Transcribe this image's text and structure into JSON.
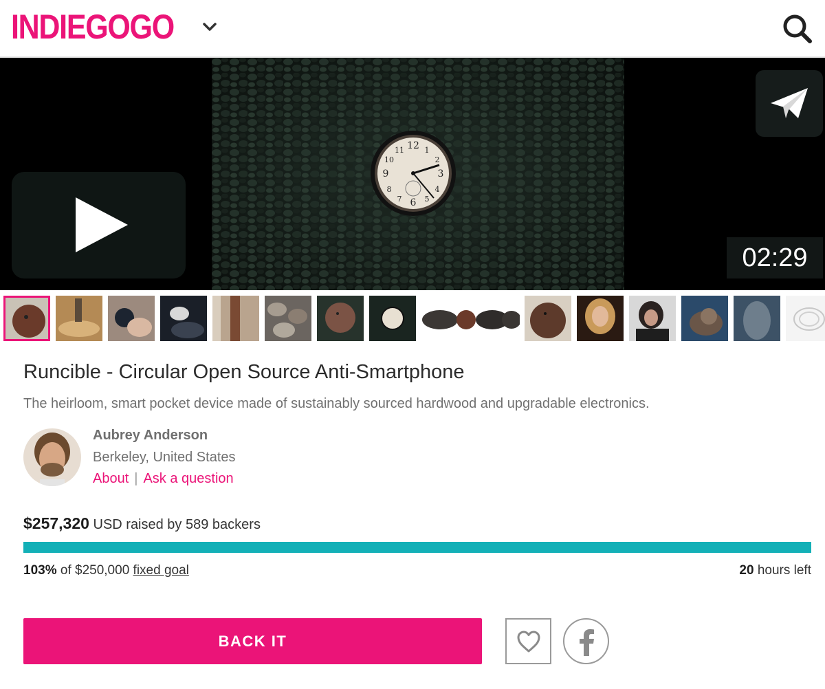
{
  "header": {
    "logo_text": "INDIEGOGO",
    "menu_icon": "chevron-down-icon",
    "search_icon": "search-icon",
    "brand_color": "#eb1478"
  },
  "video": {
    "duration": "02:29",
    "play_icon": "play-icon",
    "share_icon": "paper-plane-icon"
  },
  "gallery": {
    "thumbnails": [
      {
        "label": "wooden device with hole",
        "selected": true
      },
      {
        "label": "wood lathe"
      },
      {
        "label": "hand holding device"
      },
      {
        "label": "dark fur"
      },
      {
        "label": "wood planks"
      },
      {
        "label": "pebbles"
      },
      {
        "label": "wooden disc"
      },
      {
        "label": "pocket watch"
      },
      {
        "label": "three devices"
      },
      {
        "label": "wooden device"
      },
      {
        "label": "woman with blonde hair"
      },
      {
        "label": "woman with phone"
      },
      {
        "label": "snail"
      },
      {
        "label": "fabric"
      },
      {
        "label": "sketch"
      }
    ]
  },
  "campaign": {
    "title": "Runcible - Circular Open Source Anti-Smartphone",
    "tagline": "The heirloom, smart pocket device made of sustainably sourced hardwood and upgradable electronics.",
    "owner": {
      "name": "Aubrey Anderson",
      "location": "Berkeley, United States",
      "about_link": "About",
      "separator": "|",
      "ask_link": "Ask a question"
    },
    "funding": {
      "raised_amount": "$257,320",
      "raised_text": " USD raised by 589 backers",
      "progress_fraction": 1.0,
      "percent": "103%",
      "of_text": " of $250,000 ",
      "goal_type": "fixed goal",
      "time_value": "20",
      "time_unit": " hours left",
      "progress_color": "#13b0b7"
    },
    "actions": {
      "back_label": "BACK IT",
      "follow_icon": "heart-icon",
      "facebook_icon": "facebook-icon"
    }
  }
}
